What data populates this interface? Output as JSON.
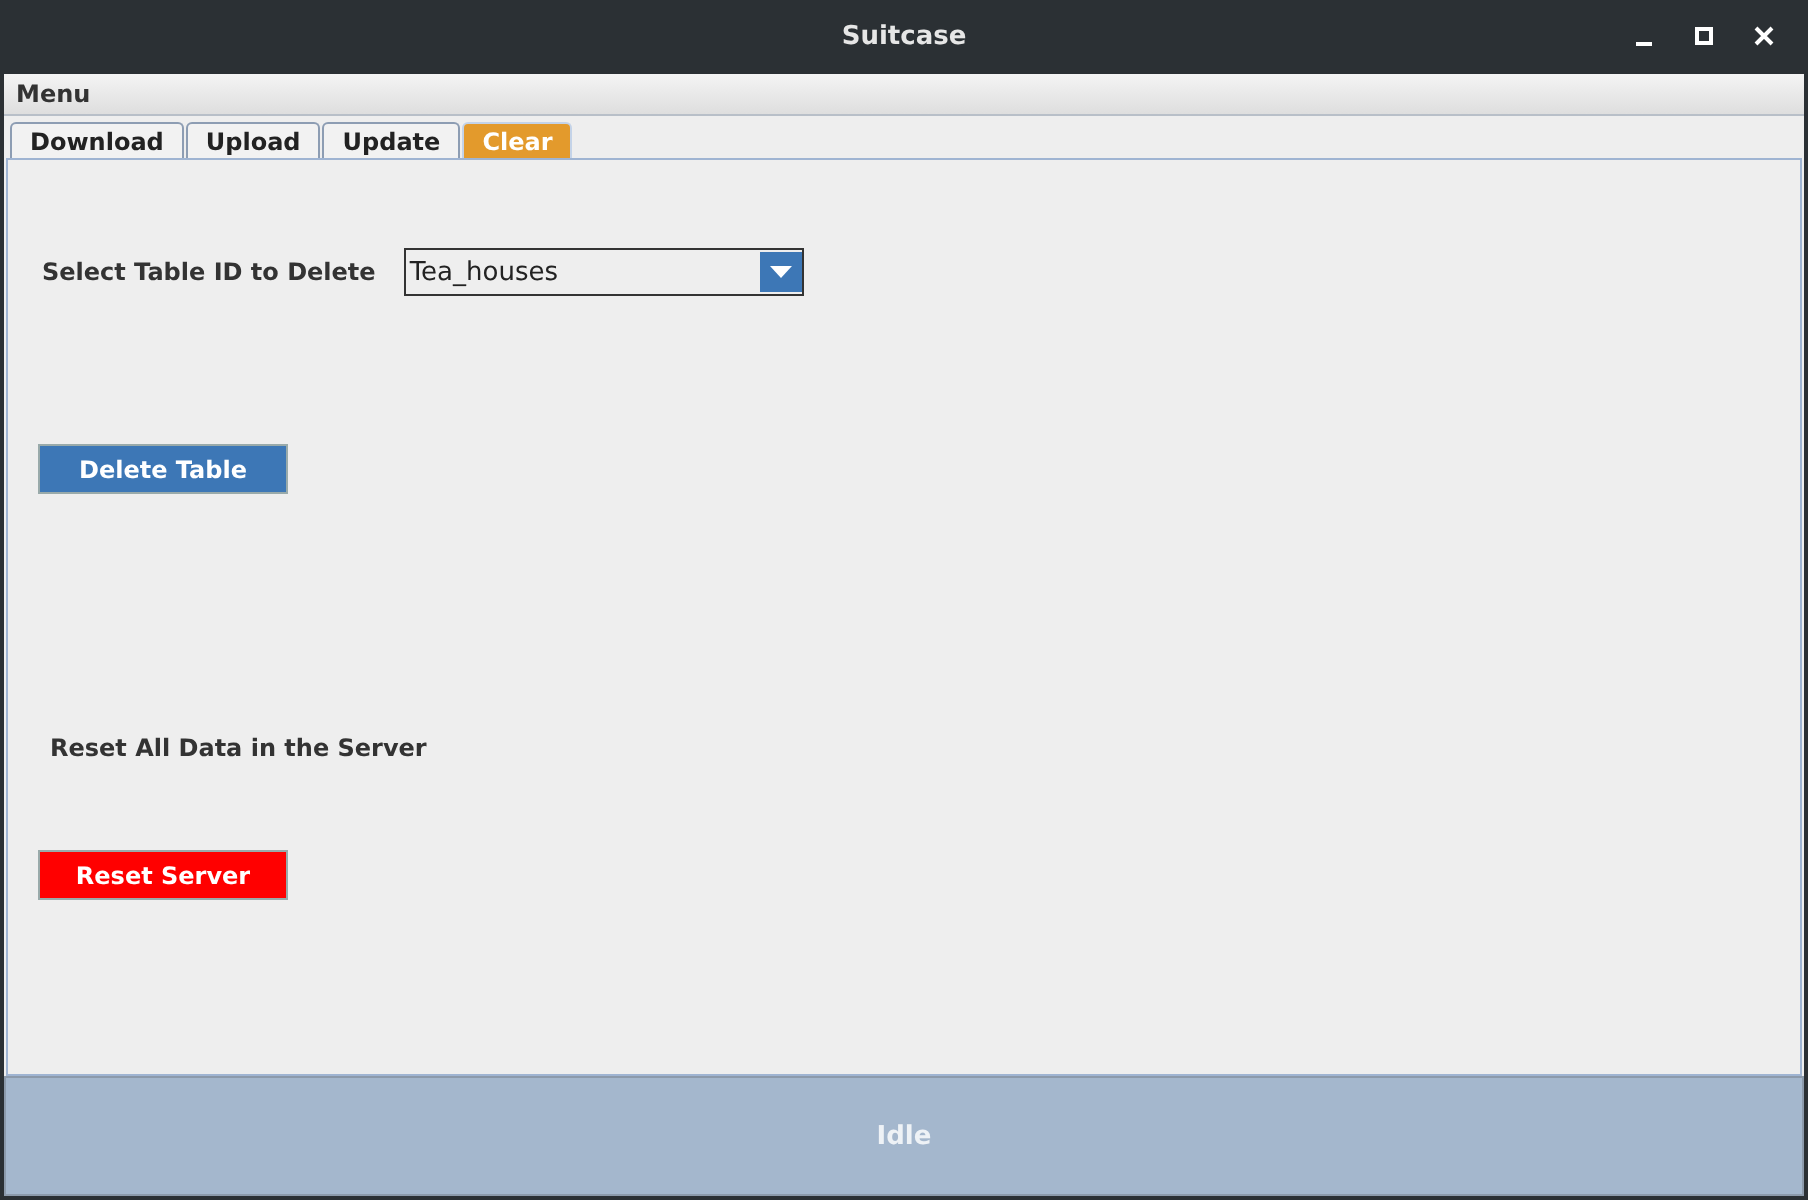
{
  "window": {
    "title": "Suitcase"
  },
  "menu_bar": [
    "Menu"
  ],
  "tabs": [
    {
      "label": "Download",
      "selected": false
    },
    {
      "label": "Upload",
      "selected": false
    },
    {
      "label": "Update",
      "selected": false
    },
    {
      "label": "Clear",
      "selected": true
    }
  ],
  "delete_section": {
    "label": "Select Table ID to Delete",
    "dropdown_value": "Tea_houses",
    "button": {
      "label": "Delete Table",
      "kind": "primary"
    }
  },
  "reset_section": {
    "label": "Reset All Data in the Server",
    "button": {
      "label": "Reset Server",
      "kind": "danger"
    }
  },
  "status_bar": "Idle"
}
